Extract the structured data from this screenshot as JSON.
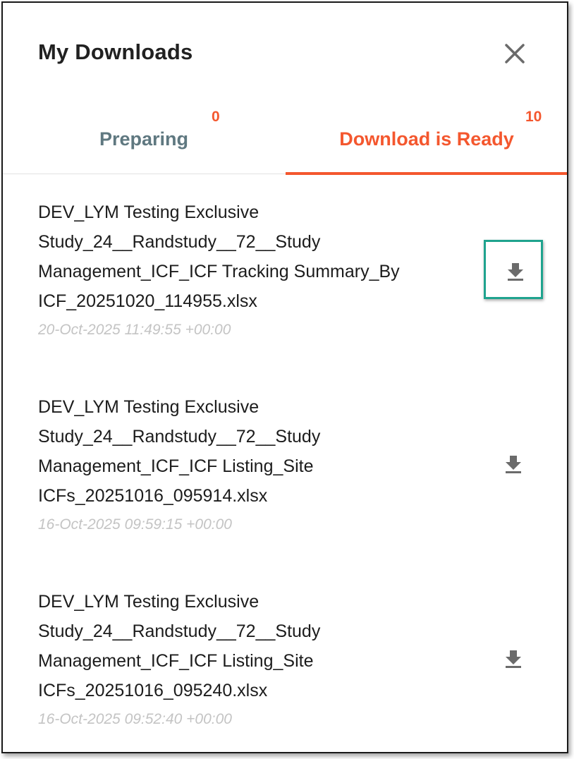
{
  "header": {
    "title": "My Downloads"
  },
  "tabs": [
    {
      "label": "Preparing",
      "count": "0"
    },
    {
      "label": "Download is Ready",
      "count": "10",
      "active": true
    }
  ],
  "downloads": [
    {
      "name": "DEV_LYM Testing Exclusive Study_24__Randstudy__72__Study Management_ICF_ICF Tracking Summary_By ICF_20251020_114955.xlsx",
      "timestamp": "20-Oct-2025 11:49:55 +00:00",
      "highlighted": true
    },
    {
      "name": "DEV_LYM Testing Exclusive Study_24__Randstudy__72__Study Management_ICF_ICF Listing_Site ICFs_20251016_095914.xlsx",
      "timestamp": "16-Oct-2025 09:59:15 +00:00"
    },
    {
      "name": "DEV_LYM Testing Exclusive Study_24__Randstudy__72__Study Management_ICF_ICF Listing_Site ICFs_20251016_095240.xlsx",
      "timestamp": "16-Oct-2025 09:52:40 +00:00"
    }
  ],
  "colors": {
    "accent": "#f4572e",
    "inactive_tab": "#5f7880",
    "highlight_border": "#1fa38e",
    "timestamp": "#c4c4c4"
  },
  "icons": {
    "close": "close-icon",
    "download": "download-icon"
  }
}
